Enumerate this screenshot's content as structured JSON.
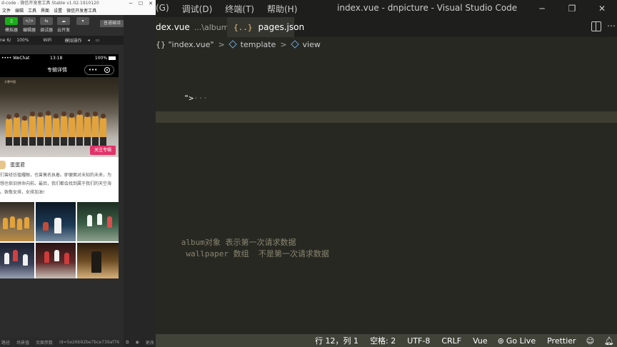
{
  "vscode": {
    "menu": [
      "(G)",
      "调试(D)",
      "终端(T)",
      "帮助(H)"
    ],
    "window_title": "index.vue - dnpicture - Visual Studio Code",
    "tabs": [
      {
        "name": "dex.vue",
        "path": "...\\album",
        "close": "×",
        "active": true
      },
      {
        "name": "pages.json",
        "icon": "{..}",
        "active": false
      }
    ],
    "breadcrumb": {
      "file": "{} \"index.vue\"",
      "items": [
        "template",
        "view"
      ]
    },
    "code": {
      "line_a": "\">",
      "line_a_fold": "···",
      "comment_1": "album对象 表示第一次请求数据",
      "comment_2": " wallpaper 数组  不是第一次请求数据",
      "fragment": "•>"
    },
    "status": {
      "position": "行 12，列 1",
      "spaces": "空格: 2",
      "encoding": "UTF-8",
      "eol": "CRLF",
      "language": "Vue",
      "golive": "Go Live",
      "prettier": "Prettier"
    }
  },
  "wechat": {
    "title": "d-code - 微信开发者工具 Stable v1.02.1910120",
    "menu": [
      "文件",
      "编辑",
      "工具",
      "界面",
      "设置",
      "微信开发者工具"
    ],
    "tools": [
      {
        "label": "模拟器",
        "glyph": "▯"
      },
      {
        "label": "编辑器",
        "glyph": "</>"
      },
      {
        "label": "调试器",
        "glyph": "⇆"
      },
      {
        "label": "云开发",
        "glyph": "☁"
      }
    ],
    "compile_mode": "普通编译",
    "more": "»",
    "device": {
      "model": "ne 6/",
      "zoom": "100%",
      "network": "WiFi",
      "action": "模拟操作"
    },
    "bottom": {
      "path": "路径",
      "scene": "场景值",
      "params": "页面参数",
      "id": "id=5e26b92be7bce739af76",
      "extra": "更改"
    },
    "phone": {
      "carrier": "•••• WeChat",
      "time": "13:18",
      "battery": "100%",
      "nav_title": "专辑详情",
      "capsule_dots": "•••",
      "follow": "关注专辑",
      "author": "蛋蛋君",
      "desc_lines": [
        "们曾经彷徨耀眼，也曾莫名执着。即便面对未知的未来，为",
        "想也依旧拼命向前。最后，我们都会找到属于我们的天空海",
        "。致敬女排，女排加油!"
      ],
      "logo": "大寒中国"
    }
  }
}
